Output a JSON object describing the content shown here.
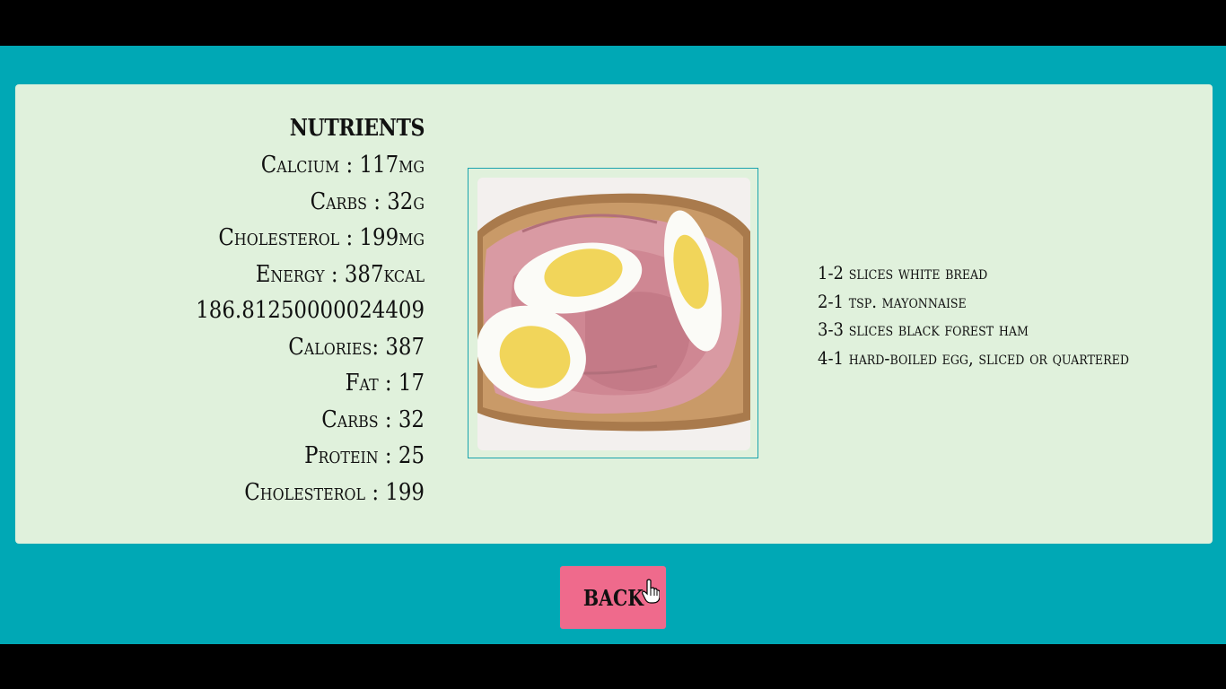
{
  "nutrients": {
    "title": "NUTRIENTS",
    "rows": [
      "Calcium : 117mg",
      "Carbs : 32g",
      "Cholesterol : 199mg",
      "Energy : 387kcal",
      "186.81250000024409",
      "Calories: 387",
      "Fat : 17",
      "Carbs : 32",
      "Protein : 25",
      "Cholesterol : 199"
    ]
  },
  "photo": {
    "subject": "open-faced ham sandwich with hard-boiled eggs"
  },
  "ingredients": [
    "1-2 slices white bread",
    "2-1 tsp. mayonnaise",
    "3-3 slices black forest ham",
    "4-1 hard-boiled egg, sliced or quartered"
  ],
  "back_button": {
    "label": "BACK"
  },
  "colors": {
    "page_bg": "#00a8b5",
    "card_bg": "#e0f1dc",
    "button_bg": "#ef6a8c"
  }
}
